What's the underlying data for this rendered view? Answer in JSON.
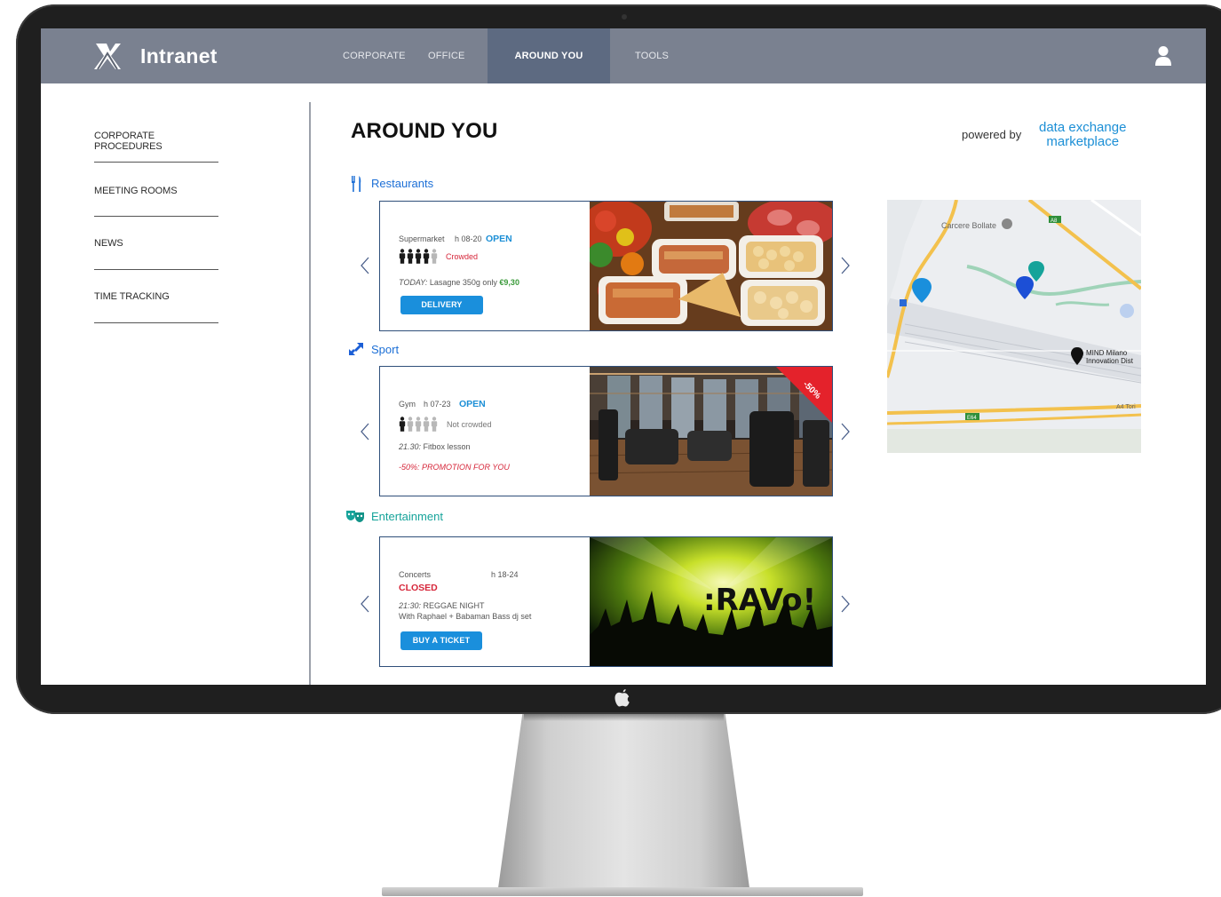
{
  "app": {
    "brand": "Intranet"
  },
  "nav": {
    "items": [
      {
        "label": "CORPORATE"
      },
      {
        "label": "OFFICE"
      },
      {
        "label": "AROUND YOU",
        "active": true
      },
      {
        "label": "TOOLS"
      }
    ]
  },
  "sidebar": {
    "items": [
      {
        "label": "CORPORATE PROCEDURES"
      },
      {
        "label": "MEETING ROOMS"
      },
      {
        "label": "NEWS"
      },
      {
        "label": "TIME TRACKING"
      }
    ]
  },
  "main": {
    "title": "AROUND YOU",
    "powered_by": "powered by",
    "partner_logo": {
      "line1": "data exchange",
      "line2": "marketplace"
    }
  },
  "sections": {
    "restaurants": {
      "title": "Restaurants",
      "place": "Supermarket",
      "hours": "h 08-20",
      "status": "OPEN",
      "crowd": "Crowded",
      "crowd_level": 4,
      "crowd_max": 5,
      "offer_prefix": "TODAY:",
      "offer_text": " Lasagne 350g only ",
      "offer_price": "€9,30",
      "button": "DELIVERY"
    },
    "sport": {
      "title": "Sport",
      "place": "Gym",
      "hours": "h 07-23",
      "status": "OPEN",
      "crowd": "Not crowded",
      "crowd_level": 1,
      "crowd_max": 5,
      "event_time": "21.30:",
      "event_text": " Fitbox lesson",
      "promo": "-50%: PROMOTION FOR YOU",
      "badge": "-50%"
    },
    "entertainment": {
      "title": "Entertainment",
      "place": "Concerts",
      "hours": "h 18-24",
      "status": "CLOSED",
      "event_time": "21:30:",
      "event_text": " REGGAE NIGHT",
      "event_detail": "With Raphael + Babaman Bass dj set",
      "button": "BUY A TICKET",
      "image_text": ":RAVo!"
    }
  },
  "map": {
    "labels": [
      "Carcere Bollate",
      "MIND Milano",
      "Innovation Dist",
      "A4 Tori",
      "E64",
      "A8"
    ]
  },
  "colors": {
    "nav_bg": "#7a8190",
    "nav_active": "#5d6a81",
    "accent": "#1a8fdc",
    "open": "#1c8fd6",
    "closed": "#d6263a",
    "entertainment": "#16a39a"
  }
}
